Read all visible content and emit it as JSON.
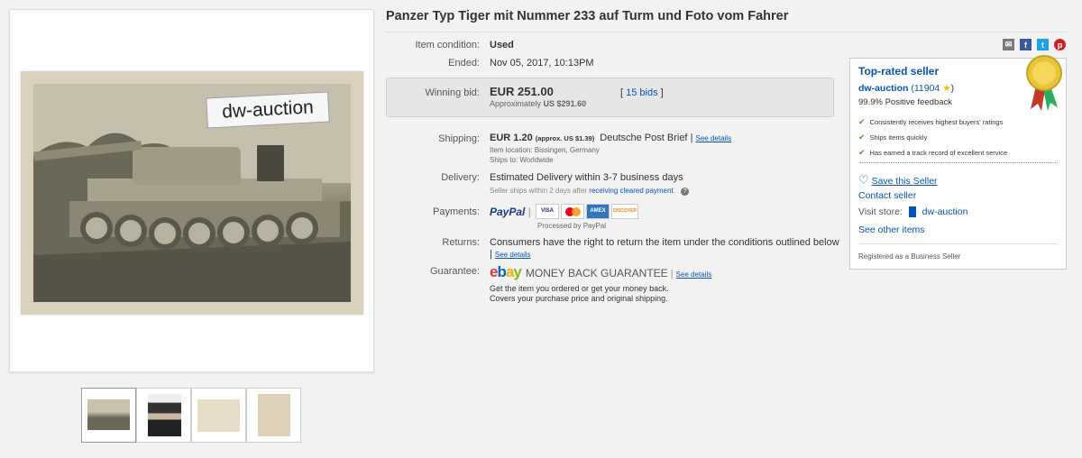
{
  "listing": {
    "title": "Panzer Typ Tiger mit Nummer 233 auf Turm und Foto vom Fahrer",
    "watermark": "dw-auction"
  },
  "item": {
    "condition_label": "Item condition:",
    "condition_value": "Used",
    "ended_label": "Ended:",
    "ended_value": "Nov 05, 2017, 10:13PM",
    "winning_bid_label": "Winning bid:",
    "winning_bid_value": "EUR 251.00",
    "approx_label": "Approximately",
    "approx_value": "US $291.60",
    "bids_link": "15 bids",
    "bids_open": "[",
    "bids_close": "]"
  },
  "shipping": {
    "label": "Shipping:",
    "price": "EUR 1.20",
    "approx": "(approx. US $1.39)",
    "service": "Deutsche Post Brief",
    "sep": "|",
    "see_details": "See details",
    "location": "Item location:  Bissingen, Germany",
    "ships_to": "Ships to:  Worldwide"
  },
  "delivery": {
    "label": "Delivery:",
    "value": "Estimated Delivery within 3-7 business days",
    "note_pre": "Seller ships within 2 days after",
    "note_link": "receiving cleared payment",
    "note_post": ".",
    "help_icon": "?"
  },
  "payments": {
    "label": "Payments:",
    "paypal": "PayPal",
    "cards": [
      "VISA",
      "MC",
      "AMEX",
      "DISCOVER"
    ],
    "processed": "Processed by PayPal"
  },
  "returns": {
    "label": "Returns:",
    "value": "Consumers have the right to return the item under the conditions outlined below",
    "sep": "|",
    "see_details": "See details"
  },
  "guarantee": {
    "label": "Guarantee:",
    "ebay": "ebay",
    "mbg": "MONEY BACK GUARANTEE",
    "sep": "|",
    "see_details": "See details",
    "line1": "Get the item you ordered or get your money back.",
    "line2": "Covers your purchase price and original shipping."
  },
  "seller": {
    "heading": "Top-rated seller",
    "name": "dw-auction",
    "score": "(11904",
    "score_close": ")",
    "feedback": "99.9% Positive feedback",
    "bullets": [
      "Consistently receives highest buyers' ratings",
      "Ships items quickly",
      "Has earned a track record of excellent service"
    ],
    "save": "Save this Seller",
    "contact": "Contact seller",
    "visit_label": "Visit store:",
    "store_name": "dw-auction",
    "other_items": "See other items",
    "registered": "Registered as a Business Seller"
  },
  "colors": {
    "link": "#0654ba",
    "check": "#4a9a3b",
    "ribbon_gold": "#e8c43a"
  }
}
